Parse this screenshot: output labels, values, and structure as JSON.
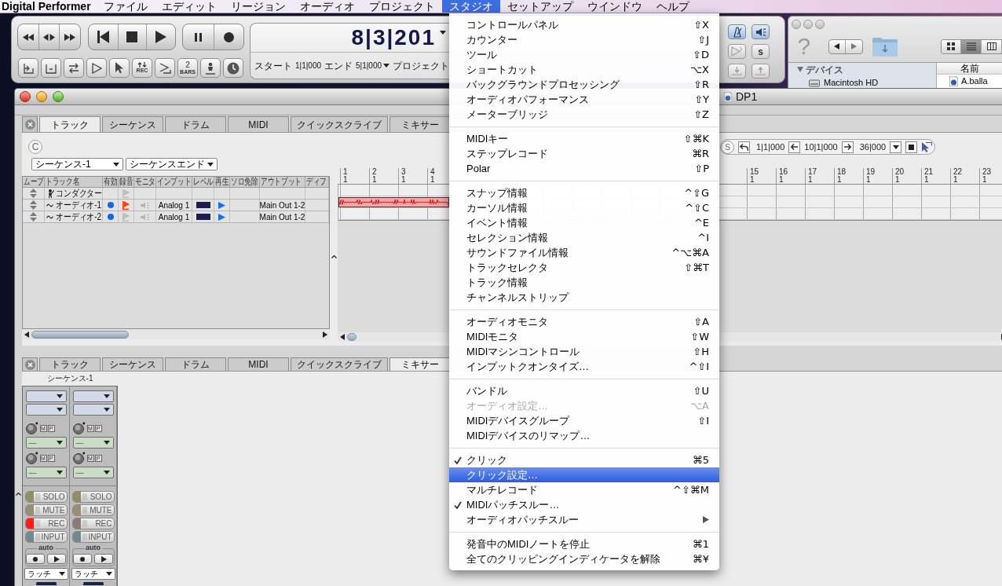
{
  "menu_bar": {
    "app_name": "Digital Performer",
    "items": [
      {
        "label": "ファイル",
        "selected": false
      },
      {
        "label": "エディット",
        "selected": false
      },
      {
        "label": "リージョン",
        "selected": false
      },
      {
        "label": "オーディオ",
        "selected": false
      },
      {
        "label": "プロジェクト",
        "selected": false
      },
      {
        "label": "スタジオ",
        "selected": true
      },
      {
        "label": "セットアップ",
        "selected": false
      },
      {
        "label": "ウインドウ",
        "selected": false
      },
      {
        "label": "ヘルプ",
        "selected": false
      }
    ]
  },
  "studio_menu": {
    "groups": [
      [
        {
          "label": "コントロールパネル",
          "shortcut": "⇧X",
          "checked": false,
          "disabled": false,
          "selected": false,
          "submenu": false
        },
        {
          "label": "カウンター",
          "shortcut": "⇧J",
          "checked": false,
          "disabled": false,
          "selected": false,
          "submenu": false
        },
        {
          "label": "ツール",
          "shortcut": "⇧D",
          "checked": false,
          "disabled": false,
          "selected": false,
          "submenu": false
        },
        {
          "label": "ショートカット",
          "shortcut": "⌥X",
          "checked": false,
          "disabled": false,
          "selected": false,
          "submenu": false
        },
        {
          "label": "バックグラウンドプロセッシング",
          "shortcut": "⇧R",
          "checked": false,
          "disabled": false,
          "selected": false,
          "submenu": false
        },
        {
          "label": "オーディオパフォーマンス",
          "shortcut": "⇧Y",
          "checked": false,
          "disabled": false,
          "selected": false,
          "submenu": false
        },
        {
          "label": "メーターブリッジ",
          "shortcut": "⇧Z",
          "checked": false,
          "disabled": false,
          "selected": false,
          "submenu": false
        }
      ],
      [
        {
          "label": "MIDIキー",
          "shortcut": "⇧⌘K",
          "checked": false,
          "disabled": false,
          "selected": false,
          "submenu": false
        },
        {
          "label": "ステップレコード",
          "shortcut": "⌘R",
          "checked": false,
          "disabled": false,
          "selected": false,
          "submenu": false
        },
        {
          "label": "Polar",
          "shortcut": "⇧P",
          "checked": false,
          "disabled": false,
          "selected": false,
          "submenu": false
        }
      ],
      [
        {
          "label": "スナップ情報",
          "shortcut": "^⇧G",
          "checked": false,
          "disabled": false,
          "selected": false,
          "submenu": false
        },
        {
          "label": "カーソル情報",
          "shortcut": "^⇧C",
          "checked": false,
          "disabled": false,
          "selected": false,
          "submenu": false
        },
        {
          "label": "イベント情報",
          "shortcut": "^E",
          "checked": false,
          "disabled": false,
          "selected": false,
          "submenu": false
        },
        {
          "label": "セレクション情報",
          "shortcut": "^I",
          "checked": false,
          "disabled": false,
          "selected": false,
          "submenu": false
        },
        {
          "label": "サウンドファイル情報",
          "shortcut": "^⌥⌘A",
          "checked": false,
          "disabled": false,
          "selected": false,
          "submenu": false
        },
        {
          "label": "トラックセレクタ",
          "shortcut": "⇧⌘T",
          "checked": false,
          "disabled": false,
          "selected": false,
          "submenu": false
        },
        {
          "label": "トラック情報",
          "checked": false,
          "disabled": false,
          "selected": false,
          "submenu": false
        },
        {
          "label": "チャンネルストリップ",
          "checked": false,
          "disabled": false,
          "selected": false,
          "submenu": false
        }
      ],
      [
        {
          "label": "オーディオモニタ",
          "shortcut": "⇧A",
          "checked": false,
          "disabled": false,
          "selected": false,
          "submenu": false
        },
        {
          "label": "MIDIモニタ",
          "shortcut": "⇧W",
          "checked": false,
          "disabled": false,
          "selected": false,
          "submenu": false
        },
        {
          "label": "MIDIマシンコントロール",
          "shortcut": "⇧H",
          "checked": false,
          "disabled": false,
          "selected": false,
          "submenu": false
        },
        {
          "label": "インプットクオンタイズ…",
          "shortcut": "^⇧I",
          "checked": false,
          "disabled": false,
          "selected": false,
          "submenu": false
        }
      ],
      [
        {
          "label": "バンドル",
          "shortcut": "⇧U",
          "checked": false,
          "disabled": false,
          "selected": false,
          "submenu": false
        },
        {
          "label": "オーディオ設定…",
          "shortcut": "⌥A",
          "checked": false,
          "disabled": true,
          "selected": false,
          "submenu": false
        },
        {
          "label": "MIDIデバイスグループ",
          "shortcut": "⇧I",
          "checked": false,
          "disabled": false,
          "selected": false,
          "submenu": false
        },
        {
          "label": "MIDIデバイスのリマップ…",
          "checked": false,
          "disabled": false,
          "selected": false,
          "submenu": false
        }
      ],
      [
        {
          "label": "クリック",
          "shortcut": "⌘5",
          "checked": true,
          "disabled": false,
          "selected": false,
          "submenu": false
        },
        {
          "label": "クリック設定…",
          "checked": false,
          "disabled": false,
          "selected": true,
          "submenu": false
        },
        {
          "label": "マルチレコード",
          "shortcut": "^⇧⌘M",
          "checked": false,
          "disabled": false,
          "selected": false,
          "submenu": false
        },
        {
          "label": "MIDIパッチスルー…",
          "checked": true,
          "disabled": false,
          "selected": false,
          "submenu": false
        },
        {
          "label": "オーディオパッチスルー",
          "checked": false,
          "disabled": false,
          "selected": false,
          "submenu": true
        }
      ],
      [
        {
          "label": "発音中のMIDIノートを停止",
          "shortcut": "⌘1",
          "checked": false,
          "disabled": false,
          "selected": false,
          "submenu": false
        },
        {
          "label": "全てのクリッピングインディケータを解除",
          "shortcut": "⌘¥",
          "checked": false,
          "disabled": false,
          "selected": false,
          "submenu": false
        }
      ]
    ]
  },
  "transport": {
    "counter": "8|3|201",
    "start_label": "スタート",
    "start": "1|1|000",
    "end_label": "エンド",
    "end": "5|1|000",
    "project_label": "プロジェクト",
    "tool_buttons": [
      {
        "kind": "bracket-arrow"
      },
      {
        "kind": "bracket"
      },
      {
        "kind": "loop"
      },
      {
        "kind": "play-outline"
      },
      {
        "kind": "pointer"
      },
      {
        "kind": "rec",
        "label": "REC"
      },
      {
        "kind": "step"
      },
      {
        "kind": "bars",
        "count": "2",
        "label": "BARS"
      },
      {
        "kind": "figure"
      },
      {
        "kind": "clock"
      }
    ],
    "letter_button": "s"
  },
  "finder": {
    "help": "?",
    "views": [
      {
        "kind": "icons",
        "selected": false
      },
      {
        "kind": "list",
        "selected": true
      },
      {
        "kind": "columns",
        "selected": false
      }
    ],
    "sidebar_heading": "デバイス",
    "sidebar_items": [
      "Macintosh HD"
    ],
    "column": "名前",
    "files": [
      "A.balla"
    ]
  },
  "dp1": {
    "title": "DP1",
    "upper_tabs": [
      {
        "label": "トラック",
        "selected": true
      },
      {
        "label": "シーケンス",
        "selected": false
      },
      {
        "label": "ドラム",
        "selected": false
      },
      {
        "label": "MIDI",
        "selected": false
      },
      {
        "label": "クイックスクライブ",
        "selected": false
      },
      {
        "label": "ミキサー",
        "selected": false
      }
    ],
    "c_button": "C",
    "sequence_menu": "シーケンス-1",
    "end_menu": "シーケンスエンド",
    "time_range": {
      "s_button": "S",
      "start": "1|1|000",
      "end": "10|1|000",
      "length": "36|000"
    },
    "columns": [
      "ムーブ",
      "トラック名",
      "有効",
      "録音",
      "モニタ",
      "インプット",
      "レベル",
      "再生",
      "ソロ免除",
      "アウトプット",
      "ディフ"
    ],
    "tracks": [
      {
        "kind": "conductor",
        "name": "コンダクター",
        "enabled": false,
        "record": false,
        "region": false
      },
      {
        "kind": "audio",
        "name": "オーディオ-1",
        "enabled": true,
        "record": true,
        "input": "Analog 1",
        "output": "Main Out 1-2",
        "region": true
      },
      {
        "kind": "audio",
        "name": "オーディオ-2",
        "enabled": true,
        "record": false,
        "input": "Analog 1",
        "output": "Main Out 1-2",
        "region": false
      }
    ],
    "ruler_left": [
      {
        "bar": "1",
        "beat": "1"
      },
      {
        "bar": "2",
        "beat": "1"
      },
      {
        "bar": "3",
        "beat": "1"
      },
      {
        "bar": "4",
        "beat": "1"
      }
    ],
    "ruler_right": [
      {
        "bar": "15",
        "beat": "1"
      },
      {
        "bar": "16",
        "beat": "1"
      },
      {
        "bar": "17",
        "beat": "1"
      },
      {
        "bar": "18",
        "beat": "1"
      },
      {
        "bar": "19",
        "beat": "1"
      },
      {
        "bar": "20",
        "beat": "1"
      },
      {
        "bar": "21",
        "beat": "1"
      },
      {
        "bar": "22",
        "beat": "1"
      },
      {
        "bar": "23",
        "beat": "1"
      }
    ],
    "lower_tabs": [
      {
        "label": "トラック",
        "selected": false
      },
      {
        "label": "シーケンス",
        "selected": false
      },
      {
        "label": "ドラム",
        "selected": false
      },
      {
        "label": "MIDI",
        "selected": false
      },
      {
        "label": "クイックスクライブ",
        "selected": false
      },
      {
        "label": "ミキサー",
        "selected": true
      }
    ],
    "mixer_sequence": "シーケンス-1",
    "strips": [
      {
        "sends": [
          {
            "value": "—",
            "m": "M",
            "p": "P"
          },
          {
            "value": "—",
            "m": "M",
            "p": "P"
          }
        ],
        "buttons": [
          {
            "kind": "solo",
            "label": "SOLO",
            "on": false
          },
          {
            "kind": "mute",
            "label": "MUTE",
            "on": false
          },
          {
            "kind": "rec",
            "label": "REC",
            "on": true
          },
          {
            "kind": "input",
            "label": "INPUT",
            "on": false
          }
        ],
        "auto": "auto",
        "mode": "ラッチ"
      },
      {
        "sends": [
          {
            "value": "—",
            "m": "M",
            "p": "P"
          },
          {
            "value": "—",
            "m": "M",
            "p": "P"
          }
        ],
        "buttons": [
          {
            "kind": "solo",
            "label": "SOLO",
            "on": false
          },
          {
            "kind": "mute",
            "label": "MUTE",
            "on": false
          },
          {
            "kind": "rec",
            "label": "REC",
            "on": false
          },
          {
            "kind": "input",
            "label": "INPUT",
            "on": false
          }
        ],
        "auto": "auto",
        "mode": "ラッチ"
      }
    ]
  }
}
